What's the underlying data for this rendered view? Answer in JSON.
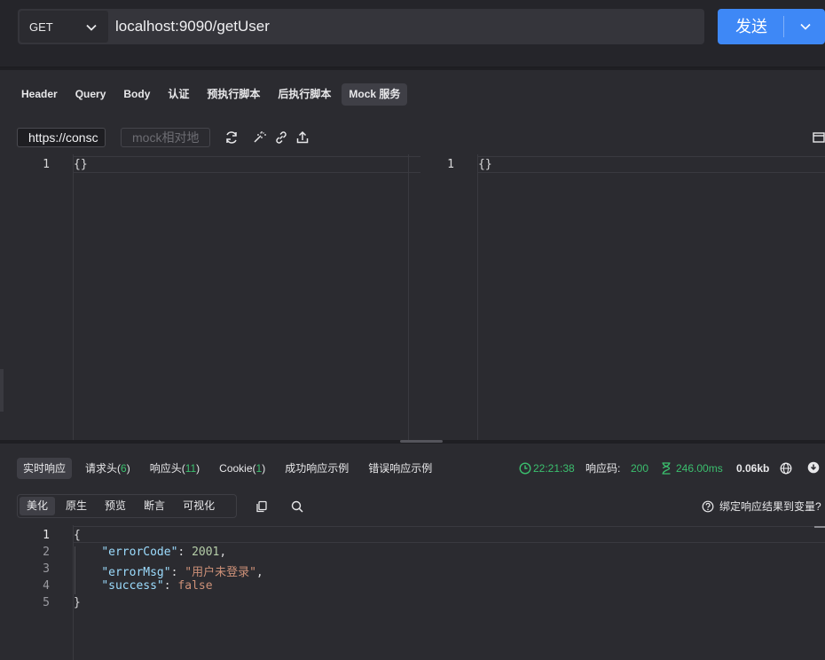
{
  "url_bar": {
    "method": "GET",
    "url": "localhost:9090/getUser",
    "send_label": "发送"
  },
  "request_tabs": [
    "Header",
    "Query",
    "Body",
    "认证",
    "预执行脚本",
    "后执行脚本",
    "Mock 服务"
  ],
  "request_tabs_active": "Mock 服务",
  "mock": {
    "url_value": "https://consc",
    "relative_placeholder": "mock相对地"
  },
  "editors": {
    "left": {
      "line": "1",
      "code": "{}"
    },
    "right": {
      "line": "1",
      "code": "{}"
    }
  },
  "response_tabs": {
    "realtime": "实时响应",
    "req_headers": "请求头(",
    "req_headers_count": "6",
    "resp_headers": "响应头(",
    "resp_headers_count": "11",
    "cookie": "Cookie(",
    "cookie_count": "1",
    "close_paren": ")",
    "success_example": "成功响应示例",
    "error_example": "错误响应示例"
  },
  "status": {
    "time": "22:21:38",
    "code_label": "响应码:",
    "code": "200",
    "duration": "246.00ms",
    "size": "0.06kb"
  },
  "format_tabs": [
    "美化",
    "原生",
    "预览",
    "断言",
    "可视化"
  ],
  "format_tabs_active": "美化",
  "bind_variable": "绑定响应结果到变量?",
  "response_body": {
    "lines": [
      "1",
      "2",
      "3",
      "4",
      "5"
    ],
    "open_brace": "{",
    "close_brace": "}",
    "key1": "\"errorCode\"",
    "val1": "2001",
    "key2": "\"errorMsg\"",
    "val2": "\"用户未登录\"",
    "key3": "\"success\"",
    "val3": "false"
  },
  "colors": {
    "accent": "#3e88f6",
    "success": "#3bbf6e",
    "background": "#2b2b30"
  }
}
